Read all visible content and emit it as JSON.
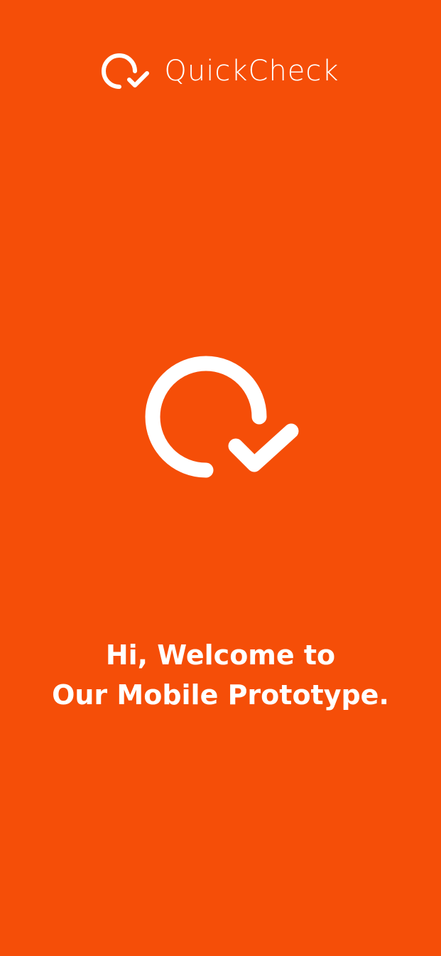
{
  "app": {
    "name": "QuickCheck",
    "background_color": "#F54E08",
    "foreground_color": "#FFFFFF"
  },
  "header": {
    "logo_icon": "quickcheck-logo-icon",
    "brand_name": "QuickCheck"
  },
  "hero": {
    "icon": "quickcheck-logo-icon"
  },
  "welcome": {
    "line1": "Hi, Welcome to",
    "line2": "Our Mobile Prototype."
  }
}
